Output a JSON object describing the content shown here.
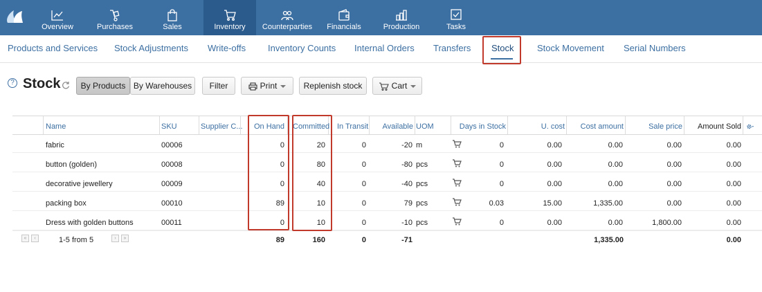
{
  "topnav": {
    "items": [
      {
        "label": "Overview",
        "icon": "chart-line-icon"
      },
      {
        "label": "Purchases",
        "icon": "dolly-icon"
      },
      {
        "label": "Sales",
        "icon": "shopping-bag-icon"
      },
      {
        "label": "Inventory",
        "icon": "cart-icon",
        "active": true
      },
      {
        "label": "Counterparties",
        "icon": "people-icon"
      },
      {
        "label": "Financials",
        "icon": "wallet-icon"
      },
      {
        "label": "Production",
        "icon": "factory-icon"
      },
      {
        "label": "Tasks",
        "icon": "checkbox-icon"
      }
    ]
  },
  "subnav": {
    "items": [
      "Products and Services",
      "Stock Adjustments",
      "Write-offs",
      "Inventory Counts",
      "Internal Orders",
      "Transfers",
      "Stock",
      "Stock Movement",
      "Serial Numbers"
    ],
    "active": "Stock"
  },
  "toolbar": {
    "help": "?",
    "title": "Stock",
    "by_products": "By Products",
    "by_warehouses": "By Warehouses",
    "filter": "Filter",
    "print": "Print",
    "replenish": "Replenish stock",
    "cart": "Cart"
  },
  "table": {
    "headers": [
      "Name",
      "SKU",
      "Supplier C...",
      "On Hand",
      "Committed",
      "In Transit",
      "Available",
      "UOM",
      "Days in Stock",
      "U. cost",
      "Cost amount",
      "Sale price",
      "Amount Sold"
    ],
    "rows": [
      {
        "name": "fabric",
        "sku": "00006",
        "on_hand": "0",
        "committed": "20",
        "in_transit": "0",
        "available": "-20",
        "uom": "m",
        "days": "0",
        "ucost": "0.00",
        "cost_amount": "0.00",
        "sale_price": "0.00",
        "amount_sold": "0.00"
      },
      {
        "name": "button (golden)",
        "sku": "00008",
        "on_hand": "0",
        "committed": "80",
        "in_transit": "0",
        "available": "-80",
        "uom": "pcs",
        "days": "0",
        "ucost": "0.00",
        "cost_amount": "0.00",
        "sale_price": "0.00",
        "amount_sold": "0.00"
      },
      {
        "name": "decorative jewellery",
        "sku": "00009",
        "on_hand": "0",
        "committed": "40",
        "in_transit": "0",
        "available": "-40",
        "uom": "pcs",
        "days": "0",
        "ucost": "0.00",
        "cost_amount": "0.00",
        "sale_price": "0.00",
        "amount_sold": "0.00"
      },
      {
        "name": "packing box",
        "sku": "00010",
        "on_hand": "89",
        "committed": "10",
        "in_transit": "0",
        "available": "79",
        "uom": "pcs",
        "days": "0.03",
        "ucost": "15.00",
        "cost_amount": "1,335.00",
        "sale_price": "0.00",
        "amount_sold": "0.00"
      },
      {
        "name": "Dress with golden buttons",
        "sku": "00011",
        "on_hand": "0",
        "committed": "10",
        "in_transit": "0",
        "available": "-10",
        "uom": "pcs",
        "days": "0",
        "ucost": "0.00",
        "cost_amount": "0.00",
        "sale_price": "1,800.00",
        "amount_sold": "0.00"
      }
    ],
    "totals": {
      "on_hand": "89",
      "committed": "160",
      "in_transit": "0",
      "available": "-71",
      "cost_amount": "1,335.00",
      "amount_sold": "0.00"
    },
    "pager": "1-5 from 5"
  },
  "colors": {
    "nav_bg": "#3c6fa2",
    "nav_active": "#2b5b8c",
    "link": "#3c6fa2",
    "highlight": "#c0392b"
  }
}
